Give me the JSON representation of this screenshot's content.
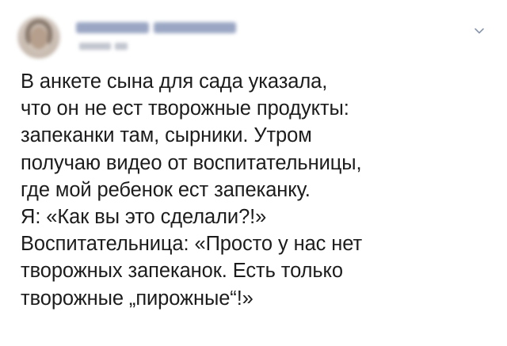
{
  "post": {
    "author_name": "",
    "author_handle": "",
    "chevron_icon": "chevron-down-icon",
    "lines": [
      "В анкете сына для сада указала,",
      "что он не ест творожные продукты:",
      "запеканки там, сырники. Утром",
      "получаю видео от воспитательницы,",
      "где мой ребенок ест запеканку.",
      "Я: «Как вы это сделали?!»",
      "Воспитательница: «Просто у нас нет",
      "творожных запеканок. Есть только",
      "творожные „пирожные“!»"
    ]
  },
  "colors": {
    "text": "#1c1c1c",
    "name_blur": "#9aa6c3",
    "handle_blur": "#c2c6cf",
    "chevron": "#8a98ad",
    "background": "#ffffff"
  }
}
